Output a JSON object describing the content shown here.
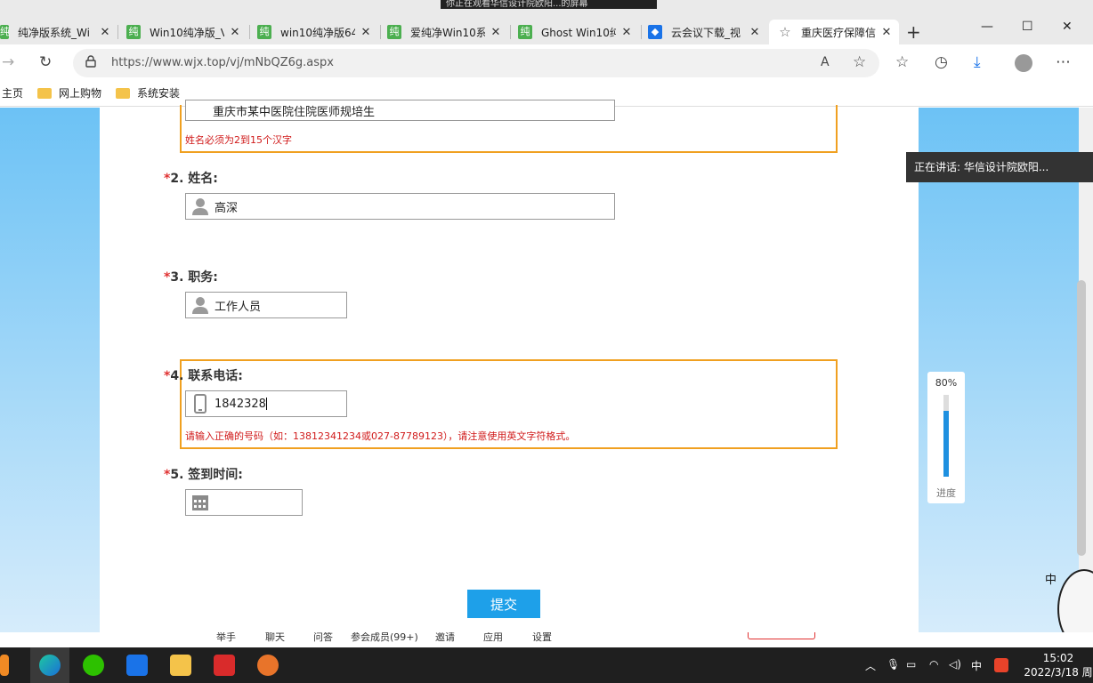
{
  "top_strip": "你正在观看华信设计院欧阳...的屏幕",
  "tabs": [
    {
      "label": "纯净版系统_Wi",
      "icon": "纯"
    },
    {
      "label": "Win10纯净版_V",
      "icon": "纯"
    },
    {
      "label": "win10纯净版64",
      "icon": "纯"
    },
    {
      "label": "爱纯净Win10系",
      "icon": "纯"
    },
    {
      "label": "Ghost Win10纯",
      "icon": "纯"
    },
    {
      "label": "云会议下载_视",
      "icon": ""
    },
    {
      "label": "重庆医疗保障信",
      "icon": ""
    }
  ],
  "url": "https://www.wjx.top/vj/mNbQZ6g.aspx",
  "bookmarks": [
    "主页",
    "网上购物",
    "系统安装"
  ],
  "form": {
    "q1_value": "重庆市某中医院住院医师规培生",
    "q1_error": "姓名必须为2到15个汉字",
    "q2_num": "2.",
    "q2_label": "姓名:",
    "q2_value": "高深",
    "q3_num": "3.",
    "q3_label": "职务:",
    "q3_value": "工作人员",
    "q4_num": "4.",
    "q4_label": "联系电话:",
    "q4_value": "1842328",
    "q4_error": "请输入正确的号码（如：13812341234或027-87789123），请注意使用英文字符格式。",
    "q5_num": "5.",
    "q5_label": "签到时间:",
    "required_mark": "*",
    "submit": "提交"
  },
  "progress": {
    "percent_label": "80%",
    "fraction": 0.8,
    "label": "进度"
  },
  "speaker": "正在讲话: 华信设计院欧阳...",
  "meeting_toolbar": [
    "举手",
    "聊天",
    "问答",
    "参会成员(99+)",
    "邀请",
    "应用",
    "设置"
  ],
  "tray": {
    "ime": "中",
    "time": "15:02",
    "date": "2022/3/18 周"
  },
  "colors": {
    "accent": "#1ea0e9",
    "error": "#d01a1a",
    "highlight_border": "#f0a020"
  }
}
